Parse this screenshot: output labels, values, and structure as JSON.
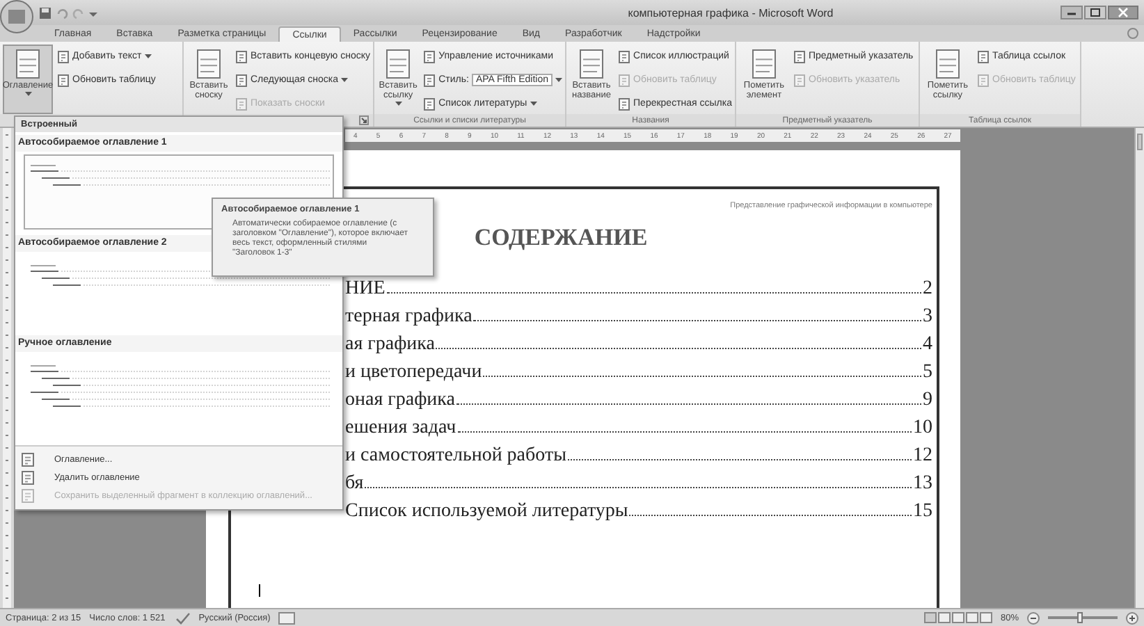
{
  "window": {
    "title": "компьютерная графика - Microsoft Word"
  },
  "tabs": [
    {
      "label": "Главная",
      "selected": false
    },
    {
      "label": "Вставка",
      "selected": false
    },
    {
      "label": "Разметка страницы",
      "selected": false
    },
    {
      "label": "Ссылки",
      "selected": true
    },
    {
      "label": "Рассылки",
      "selected": false
    },
    {
      "label": "Рецензирование",
      "selected": false
    },
    {
      "label": "Вид",
      "selected": false
    },
    {
      "label": "Разработчик",
      "selected": false
    },
    {
      "label": "Надстройки",
      "selected": false
    }
  ],
  "ribbon": {
    "groups": [
      {
        "items": [
          {
            "kind": "large",
            "label": "Оглавление",
            "menu": true,
            "pressed": true
          },
          {
            "kind": "small",
            "label": "Добавить текст",
            "menu": true,
            "disabled": false
          },
          {
            "kind": "small",
            "label": "Обновить таблицу",
            "disabled": false
          }
        ]
      },
      {
        "launcher": true,
        "items": [
          {
            "kind": "large",
            "label": "Вставить сноску",
            "pressed": false
          },
          {
            "kind": "small",
            "label": "Вставить концевую сноску",
            "disabled": false
          },
          {
            "kind": "small",
            "label": "Следующая сноска",
            "menu": true,
            "disabled": false
          },
          {
            "kind": "small",
            "label": "Показать сноски",
            "disabled": true
          }
        ]
      },
      {
        "label": "Ссылки и списки литературы",
        "items": [
          {
            "kind": "large",
            "label": "Вставить ссылку",
            "menu": true,
            "pressed": false
          },
          {
            "kind": "small",
            "label": "Управление источниками",
            "disabled": false
          },
          {
            "kind": "combo",
            "label": "Стиль:",
            "value": "APA Fifth Edition",
            "menu": true,
            "disabled": false
          },
          {
            "kind": "small",
            "label": "Список литературы",
            "menu": true,
            "disabled": false
          }
        ]
      },
      {
        "label": "Названия",
        "items": [
          {
            "kind": "large",
            "label": "Вставить название",
            "pressed": false
          },
          {
            "kind": "small",
            "label": "Список иллюстраций",
            "disabled": false
          },
          {
            "kind": "small",
            "label": "Обновить таблицу",
            "disabled": true
          },
          {
            "kind": "small",
            "label": "Перекрестная ссылка",
            "disabled": false
          }
        ]
      },
      {
        "label": "Предметный указатель",
        "items": [
          {
            "kind": "large",
            "label": "Пометить элемент",
            "pressed": false
          },
          {
            "kind": "small",
            "label": "Предметный указатель",
            "disabled": false
          },
          {
            "kind": "small",
            "label": "Обновить указатель",
            "disabled": true
          }
        ]
      },
      {
        "label": "Таблица ссылок",
        "items": [
          {
            "kind": "large",
            "label": "Пометить ссылку",
            "pressed": false
          },
          {
            "kind": "small",
            "label": "Таблица ссылок",
            "disabled": false
          },
          {
            "kind": "small",
            "label": "Обновить таблицу",
            "disabled": true
          }
        ]
      }
    ]
  },
  "ruler": {
    "numbers": [
      "4",
      "5",
      "6",
      "7",
      "8",
      "9",
      "10",
      "11",
      "12",
      "13",
      "14",
      "15",
      "16",
      "17",
      "18",
      "19",
      "20",
      "21",
      "22",
      "23",
      "24",
      "25",
      "26",
      "27"
    ]
  },
  "dropdown": {
    "header": "Встроенный",
    "sections": [
      {
        "title": "Автособираемое оглавление 1",
        "kind": "auto",
        "selected": true
      },
      {
        "title": "Автособираемое оглавление 2",
        "kind": "auto",
        "selected": false
      },
      {
        "title": "Ручное оглавление",
        "kind": "manual",
        "selected": false
      }
    ],
    "commands": [
      {
        "label": "Оглавление...",
        "disabled": false
      },
      {
        "label": "Удалить оглавление",
        "disabled": false
      },
      {
        "label": "Сохранить выделенный фрагмент в коллекцию оглавлений...",
        "disabled": true
      }
    ]
  },
  "tooltip": {
    "title": "Автособираемое оглавление 1",
    "text": "Автоматически собираемое оглавление (с заголовком \"Оглавление\"), которое включает весь текст, оформленный стилями \"Заголовок 1-3\""
  },
  "document": {
    "header": "Представление графической информации в компьютере",
    "heading": "СОДЕРЖАНИЕ",
    "toc": [
      {
        "text": "НИЕ",
        "page": "2"
      },
      {
        "text": "терная графика",
        "page": "3"
      },
      {
        "text": "ая графика",
        "page": "4"
      },
      {
        "text": "и цветопередачи",
        "page": "5"
      },
      {
        "text": "оная графика",
        "page": "9"
      },
      {
        "text": "ешения задач",
        "page": "10"
      },
      {
        "text": "и самостоятельной работы",
        "page": "12"
      },
      {
        "text": "бя",
        "page": "13"
      },
      {
        "text": "Список используемой литературы",
        "page": "15"
      }
    ]
  },
  "status_bar": {
    "page": "Страница: 2 из 15",
    "words": "Число слов: 1 521",
    "language": "Русский (Россия)",
    "zoom": "80%",
    "zoom_slider": {
      "level": 0.45
    }
  }
}
